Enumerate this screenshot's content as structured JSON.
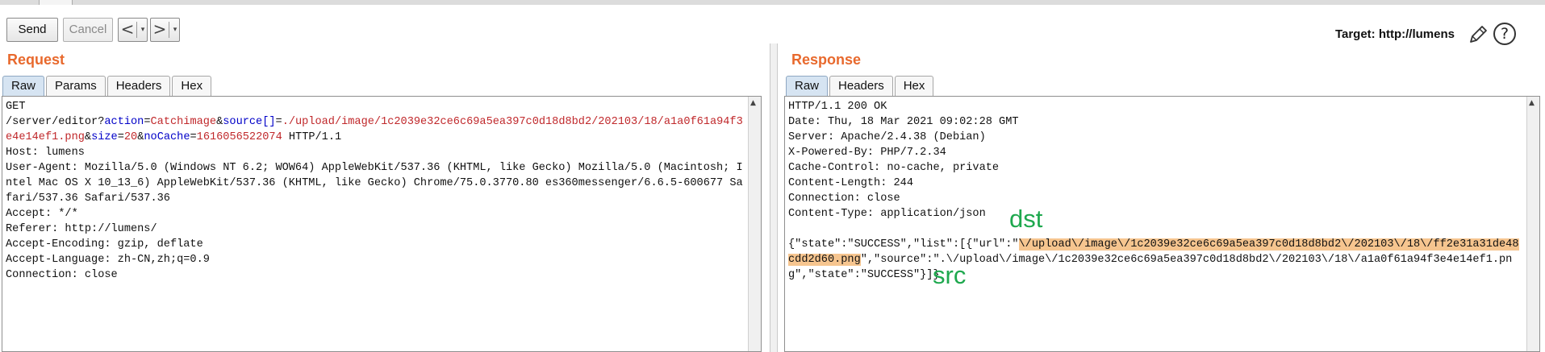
{
  "toolbar": {
    "send_label": "Send",
    "cancel_label": "Cancel",
    "back_glyph": "<",
    "forward_glyph": ">",
    "dropdown_glyph": "▾",
    "target_text": "Target: http://lumens",
    "help_glyph": "?"
  },
  "request": {
    "title": "Request",
    "tabs": [
      "Raw",
      "Params",
      "Headers",
      "Hex"
    ],
    "active_tab": "Raw",
    "method": "GET",
    "path": "/server/editor",
    "params": [
      {
        "name": "action",
        "value": "Catchimage"
      },
      {
        "name": "source[]",
        "value": "./upload/image/1c2039e32ce6c69a5ea397c0d18d8bd2/202103/18/a1a0f61a94f3e4e14ef1.png"
      },
      {
        "name": "size",
        "value": "20"
      },
      {
        "name": "noCache",
        "value": "1616056522074"
      }
    ],
    "protocol": " HTTP/1.1",
    "headers": [
      "Host: lumens",
      "User-Agent: Mozilla/5.0 (Windows NT 6.2; WOW64) AppleWebKit/537.36 (KHTML, like Gecko) Mozilla/5.0 (Macintosh; Intel Mac OS X 10_13_6) AppleWebKit/537.36 (KHTML, like Gecko) Chrome/75.0.3770.80 es360messenger/6.6.5-600677 Safari/537.36 Safari/537.36",
      "Accept: */*",
      "Referer: http://lumens/",
      "Accept-Encoding: gzip, deflate",
      "Accept-Language: zh-CN,zh;q=0.9",
      "Connection: close"
    ]
  },
  "response": {
    "title": "Response",
    "tabs": [
      "Raw",
      "Headers",
      "Hex"
    ],
    "active_tab": "Raw",
    "headers": [
      "HTTP/1.1 200 OK",
      "Date: Thu, 18 Mar 2021 09:02:28 GMT",
      "Server: Apache/2.4.38 (Debian)",
      "X-Powered-By: PHP/7.2.34",
      "Cache-Control: no-cache, private",
      "Content-Length: 244",
      "Connection: close",
      "Content-Type: application/json"
    ],
    "body_prefix": "{\"state\":\"SUCCESS\",\"list\":[{\"url\":\"",
    "body_highlight": "\\/upload\\/image\\/1c2039e32ce6c69a5ea397c0d18d8bd2\\/202103\\/18\\/ff2e31a31de48cdd2d60.png",
    "body_suffix": "\",\"source\":\".\\/upload\\/image\\/1c2039e32ce6c69a5ea397c0d18d8bd2\\/202103\\/18\\/a1a0f61a94f3e4e14ef1.png\",\"state\":\"SUCCESS\"}]}"
  },
  "annotations": {
    "dst": "dst",
    "src": "src",
    "color": "#1ea84e"
  },
  "colors": {
    "accent_orange": "#e8692d",
    "param_name": "#0000c8",
    "param_value": "#c0282b",
    "highlight": "#f6c58f"
  }
}
